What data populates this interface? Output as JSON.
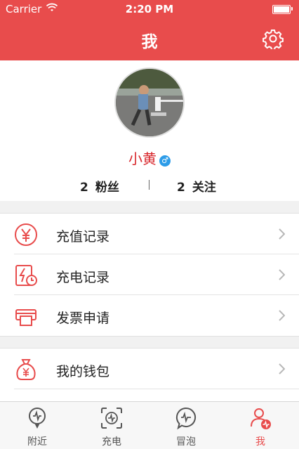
{
  "status_bar": {
    "carrier": "Carrier",
    "time": "2:20 PM"
  },
  "header": {
    "title": "我",
    "settings_icon": "gear-icon"
  },
  "profile": {
    "name": "小黄",
    "gender_symbol": "♂",
    "fans_count": "2",
    "fans_label": "粉丝",
    "following_count": "2",
    "following_label": "关注"
  },
  "menu": [
    {
      "label": "充值记录",
      "icon": "yuan-coin-icon"
    },
    {
      "label": "充电记录",
      "icon": "charge-history-icon"
    },
    {
      "label": "发票申请",
      "icon": "printer-icon"
    },
    {
      "label": "我的钱包",
      "icon": "wallet-bag-icon"
    }
  ],
  "tabs": [
    {
      "label": "附近",
      "icon": "nearby-pin-icon"
    },
    {
      "label": "充电",
      "icon": "charge-scan-icon"
    },
    {
      "label": "冒泡",
      "icon": "bubble-chat-icon"
    },
    {
      "label": "我",
      "icon": "user-profile-icon"
    }
  ],
  "active_tab": 3,
  "colors": {
    "accent": "#e84c4c",
    "gender_badge": "#2d9ce8",
    "background": "#f1f1f1"
  }
}
